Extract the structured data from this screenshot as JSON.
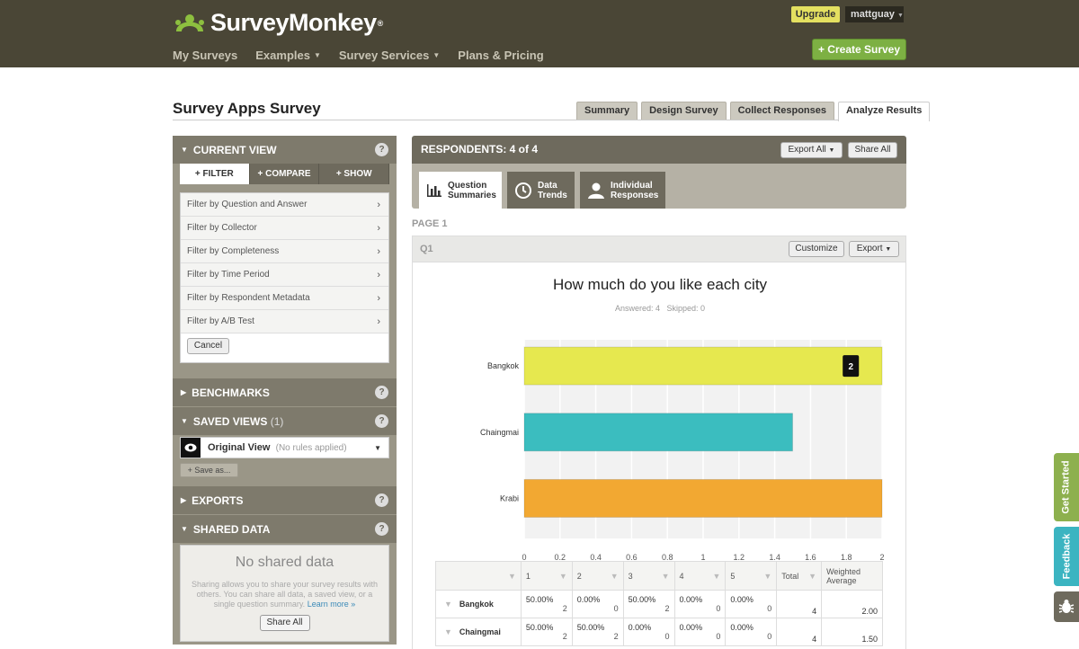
{
  "header": {
    "logo_text": "SurveyMonkey",
    "logo_mark": "®",
    "nav": [
      {
        "label": "My Surveys",
        "dropdown": false
      },
      {
        "label": "Examples",
        "dropdown": true
      },
      {
        "label": "Survey Services",
        "dropdown": true
      },
      {
        "label": "Plans & Pricing",
        "dropdown": false
      }
    ],
    "upgrade_label": "Upgrade",
    "username": "mattguay",
    "create_label": "+ Create Survey"
  },
  "survey": {
    "title": "Survey Apps Survey",
    "tabs": [
      "Summary",
      "Design Survey",
      "Collect Responses",
      "Analyze Results"
    ],
    "active_tab": "Analyze Results"
  },
  "sidebar": {
    "current_view": "CURRENT VIEW",
    "modes": [
      "+ FILTER",
      "+ COMPARE",
      "+ SHOW"
    ],
    "filters": [
      "Filter by Question and Answer",
      "Filter by Collector",
      "Filter by Completeness",
      "Filter by Time Period",
      "Filter by Respondent Metadata",
      "Filter by A/B Test"
    ],
    "cancel_label": "Cancel",
    "benchmarks": "BENCHMARKS",
    "saved_views": "SAVED VIEWS",
    "saved_count": "(1)",
    "original_view": "Original View",
    "no_rules": "(No rules applied)",
    "save_as": "+ Save as...",
    "exports": "EXPORTS",
    "shared_data": "SHARED DATA",
    "no_shared": "No shared data",
    "shared_desc": "Sharing allows you to share your survey results with others. You can share all data, a saved view, or a single question summary.",
    "learn_more": "Learn more »",
    "share_all": "Share All",
    "help": "?"
  },
  "main": {
    "respondents": "RESPONDENTS: 4 of 4",
    "export_all": "Export All",
    "share_all": "Share All",
    "content_tabs": [
      {
        "line1": "Question",
        "line2": "Summaries",
        "icon": "bar-chart-icon"
      },
      {
        "line1": "Data",
        "line2": "Trends",
        "icon": "clock-icon"
      },
      {
        "line1": "Individual",
        "line2": "Responses",
        "icon": "person-icon"
      }
    ],
    "page_label": "PAGE 1",
    "question_label": "Q1",
    "customize": "Customize",
    "export": "Export",
    "chart_title": "How much do you like each city",
    "answered": "Answered: 4",
    "skipped": "Skipped: 0",
    "tooltip_value": "2"
  },
  "chart_data": {
    "type": "bar",
    "orientation": "horizontal",
    "title": "How much do you like each city",
    "categories": [
      "Bangkok",
      "Chaingmai",
      "Krabi"
    ],
    "values": [
      2,
      1.5,
      2
    ],
    "colors": [
      "#e6e84f",
      "#3bbdbf",
      "#f2a832"
    ],
    "xlim": [
      0,
      2
    ],
    "ticks": [
      "0",
      "0.2",
      "0.4",
      "0.6",
      "0.8",
      "1",
      "1.2",
      "1.4",
      "1.6",
      "1.8",
      "2"
    ],
    "grid": true
  },
  "table": {
    "headers": [
      "1",
      "2",
      "3",
      "4",
      "5",
      "Total",
      "Weighted Average"
    ],
    "rows": [
      {
        "label": "Bangkok",
        "cells": [
          [
            "50.00%",
            "2"
          ],
          [
            "0.00%",
            "0"
          ],
          [
            "50.00%",
            "2"
          ],
          [
            "0.00%",
            "0"
          ],
          [
            "0.00%",
            "0"
          ]
        ],
        "total": "4",
        "avg": "2.00"
      },
      {
        "label": "Chaingmai",
        "cells": [
          [
            "50.00%",
            "2"
          ],
          [
            "50.00%",
            "2"
          ],
          [
            "0.00%",
            "0"
          ],
          [
            "0.00%",
            "0"
          ],
          [
            "0.00%",
            "0"
          ]
        ],
        "total": "4",
        "avg": "1.50"
      }
    ]
  },
  "side_tabs": [
    {
      "label": "Get Started",
      "color": "#8db04e"
    },
    {
      "label": "Feedback",
      "color": "#3bb4c1"
    }
  ]
}
